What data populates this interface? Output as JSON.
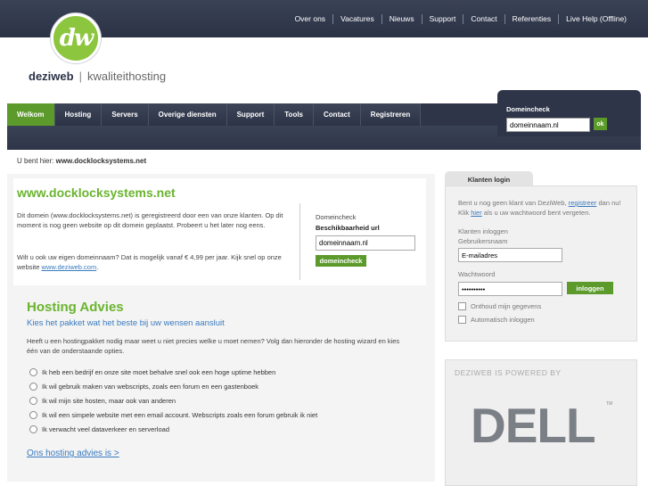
{
  "top_nav": [
    "Over ons",
    "Vacatures",
    "Nieuws",
    "Support",
    "Contact",
    "Referenties",
    "Live Help (Offline)"
  ],
  "logo": {
    "mark": "dw",
    "brand": "deziweb",
    "tagline": "kwaliteithosting"
  },
  "main_nav": [
    {
      "label": "Welkom",
      "active": true
    },
    {
      "label": "Hosting",
      "active": false
    },
    {
      "label": "Servers",
      "active": false
    },
    {
      "label": "Overige diensten",
      "active": false
    },
    {
      "label": "Support",
      "active": false
    },
    {
      "label": "Tools",
      "active": false
    },
    {
      "label": "Contact",
      "active": false
    },
    {
      "label": "Registreren",
      "active": false
    }
  ],
  "header_domeincheck": {
    "label": "Domeincheck",
    "value": "domeinnaam.nl",
    "button": "ok"
  },
  "breadcrumb": {
    "prefix": "U bent hier:",
    "current": "www.docklocksystems.net"
  },
  "main": {
    "title": "www.docklocksystems.net",
    "p1": "Dit domein (www.docklocksystems.net) is geregistreerd door een van onze klanten. Op dit moment is nog geen website op dit domein geplaatst. Probeert u het later nog eens.",
    "p2_text": "Wilt u ook uw eigen domeinnaam? Dat is mogelijk vanaf € 4,99 per jaar. Kijk snel op onze website",
    "p2_link": "www.deziweb.com",
    "p2_end": "."
  },
  "mini_domeincheck": {
    "label": "Domeincheck",
    "sub": "Beschikbaarheid url",
    "value": "domeinnaam.nl",
    "button": "domeincheck"
  },
  "hosting_advies": {
    "title": "Hosting Advies",
    "subtitle": "Kies het pakket wat het beste bij uw wensen aansluit",
    "intro": "Heeft u een hostingpakket nodig maar weet u niet precies welke u moet nemen? Volg dan hieronder de hosting wizard en kies één van de onderstaande opties.",
    "options": [
      "Ik heb een bedrijf en onze site moet behalve snel ook een hoge uptime hebben",
      "Ik wil gebruik maken van webscripts, zoals een forum en een gastenboek",
      "Ik wil mijn site hosten, maar ook van anderen",
      "Ik wil een simpele website met een email account. Webscripts zoals een forum gebruik ik niet",
      "Ik verwacht veel dataverkeer en serverload"
    ],
    "link": "Ons hosting advies is >"
  },
  "login": {
    "tab": "Klanten login",
    "intro_a": "Bent u nog geen klant van DeziWeb,",
    "intro_link1": "registreer",
    "intro_b": "dan nu! Klik",
    "intro_link2": "hier",
    "intro_c": "als u uw wachtwoord bent vergeten.",
    "section": "Klanten inloggen",
    "user_label": "Gebruikersnaam",
    "user_value": "E-mailadres",
    "pass_label": "Wachtwoord",
    "pass_value": "••••••••••",
    "button": "inloggen",
    "remember": "Onthoud mijn gegevens",
    "auto": "Automatisch inloggen"
  },
  "powered": {
    "label": "DEZIWEB IS POWERED BY",
    "brand": "DELL",
    "tm": "TM"
  }
}
